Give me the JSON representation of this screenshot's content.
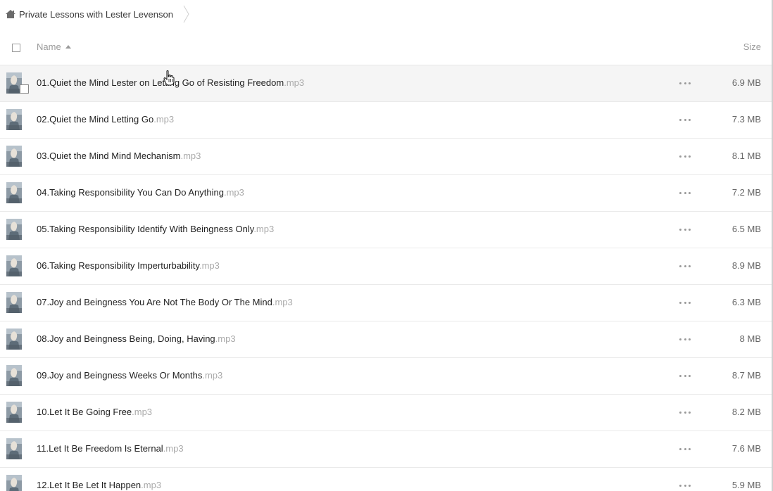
{
  "breadcrumb": {
    "label": "Private Lessons with Lester Levenson"
  },
  "header": {
    "name": "Name",
    "size": "Size"
  },
  "files": [
    {
      "name": "01.Quiet the Mind Lester on Letting Go of Resisting Freedom",
      "ext": ".mp3",
      "size": "6.9 MB"
    },
    {
      "name": "02.Quiet the Mind Letting Go",
      "ext": ".mp3",
      "size": "7.3 MB"
    },
    {
      "name": "03.Quiet the Mind Mind Mechanism",
      "ext": ".mp3",
      "size": "8.1 MB"
    },
    {
      "name": "04.Taking Responsibility You Can Do Anything",
      "ext": ".mp3",
      "size": "7.2 MB"
    },
    {
      "name": "05.Taking Responsibility Identify With Beingness Only",
      "ext": ".mp3",
      "size": "6.5 MB"
    },
    {
      "name": "06.Taking Responsibility Imperturbability",
      "ext": ".mp3",
      "size": "8.9 MB"
    },
    {
      "name": "07.Joy and Beingness You Are Not The Body Or The Mind",
      "ext": ".mp3",
      "size": "6.3 MB"
    },
    {
      "name": "08.Joy and Beingness Being, Doing, Having",
      "ext": ".mp3",
      "size": "8 MB"
    },
    {
      "name": "09.Joy and Beingness Weeks Or Months",
      "ext": ".mp3",
      "size": "8.7 MB"
    },
    {
      "name": "10.Let It Be Going Free",
      "ext": ".mp3",
      "size": "8.2 MB"
    },
    {
      "name": "11.Let It Be Freedom Is Eternal",
      "ext": ".mp3",
      "size": "7.6 MB"
    },
    {
      "name": "12.Let It Be Let It Happen",
      "ext": ".mp3",
      "size": "5.9 MB"
    }
  ],
  "colors": {
    "hover_row": "#f5f5f5",
    "ext_text": "#aaaaaa",
    "header_text": "#9a9a9a"
  }
}
